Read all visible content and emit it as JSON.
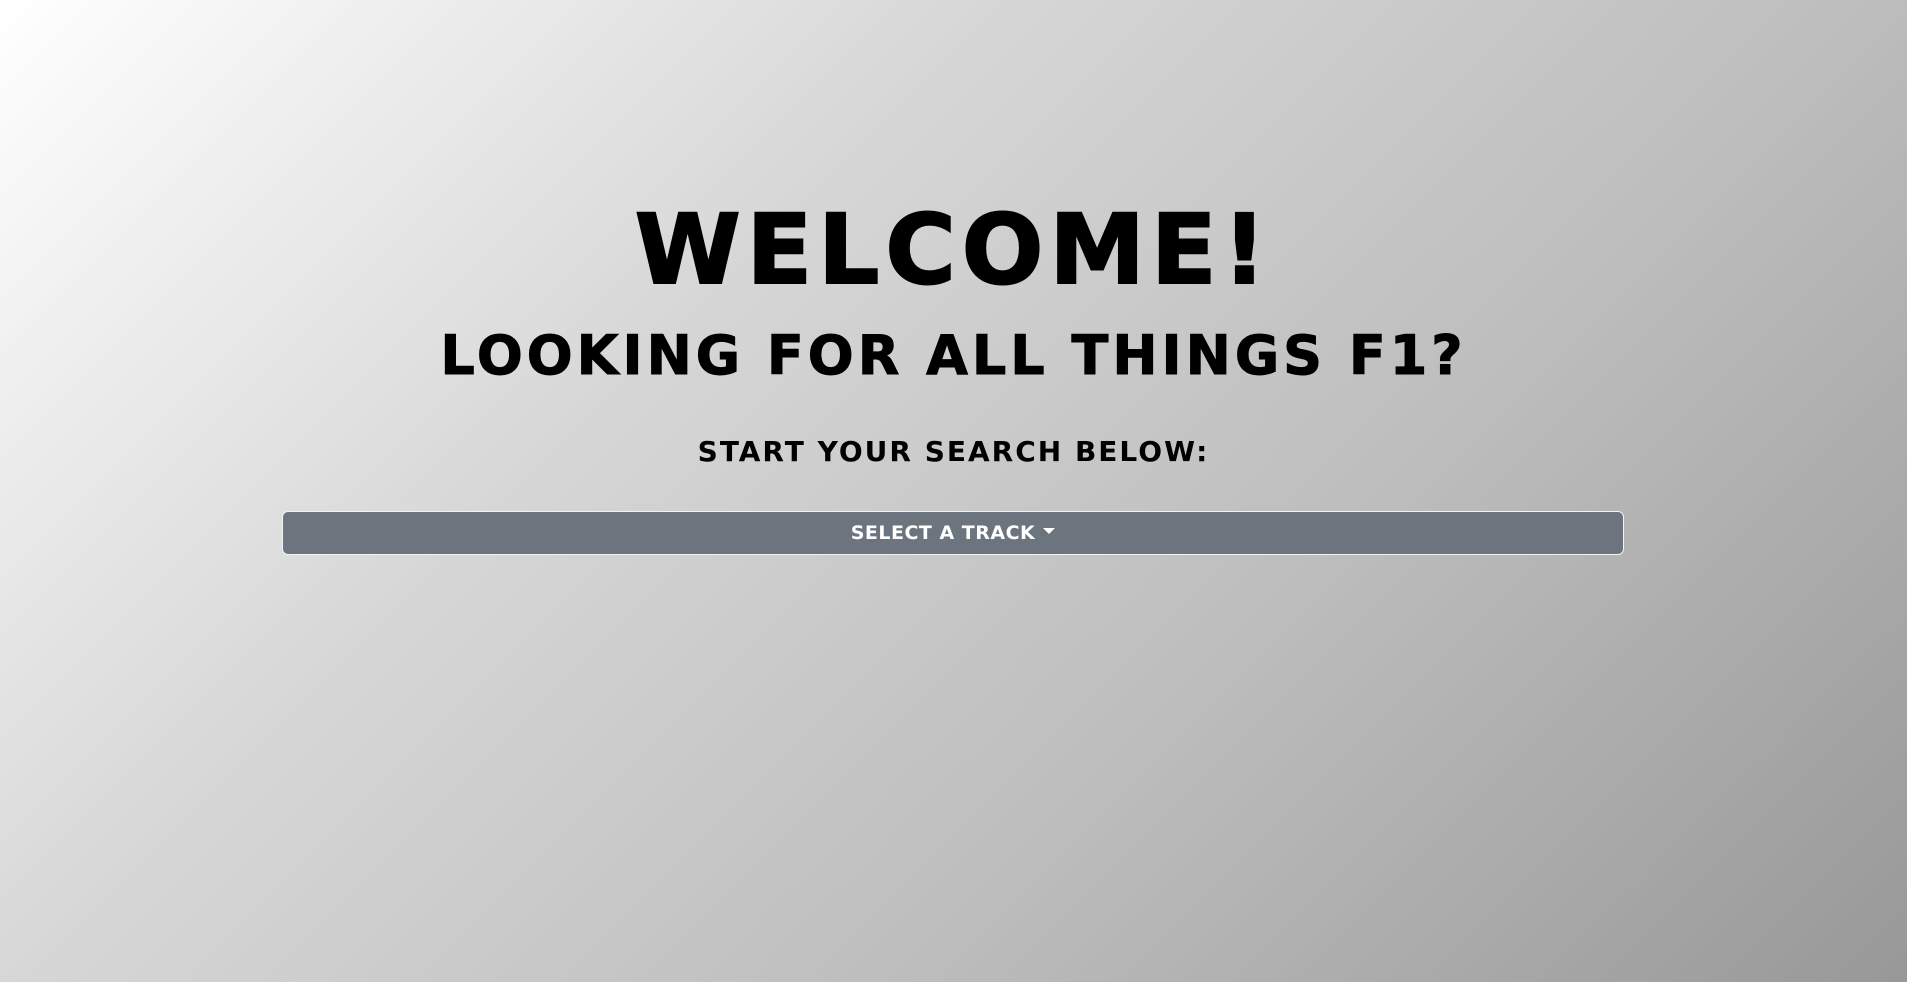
{
  "hero": {
    "title": "WELCOME!",
    "subtitle": "LOOKING FOR ALL THINGS F1?",
    "prompt": "START YOUR SEARCH BELOW:"
  },
  "dropdown": {
    "label": "SELECT A TRACK",
    "icon": "chevron-down-icon",
    "background_color": "#6c757d",
    "text_color": "#ffffff"
  },
  "theme": {
    "text_color": "#000000",
    "background_gradient": [
      "#ffffff",
      "#989898"
    ]
  }
}
